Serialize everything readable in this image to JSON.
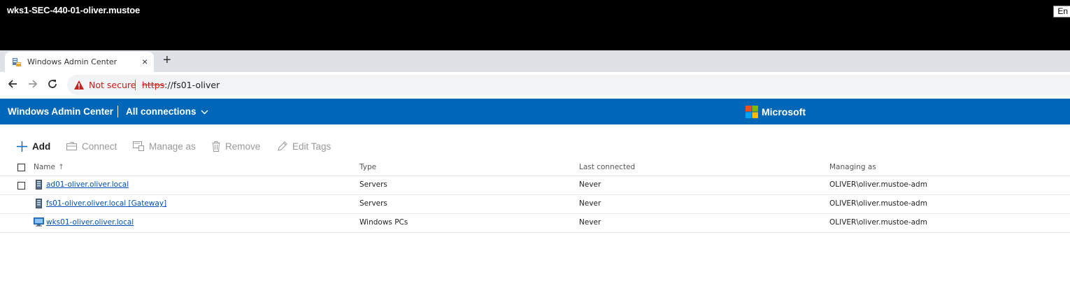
{
  "session": {
    "title": "wks1-SEC-440-01-oliver.mustoe",
    "language": "En"
  },
  "browser": {
    "tab_title": "Windows Admin Center",
    "tab_close": "×",
    "new_tab": "+",
    "not_secure": "Not secure",
    "url_scheme": "https",
    "url_rest": "://fs01-oliver"
  },
  "app": {
    "name": "Windows Admin Center",
    "connections_label": "All connections",
    "brand": "Microsoft",
    "brand_colors": [
      "#f25022",
      "#7fba00",
      "#00a4ef",
      "#ffb900"
    ],
    "header_color": "#0067b8"
  },
  "commands": {
    "add": "Add",
    "connect": "Connect",
    "manage_as": "Manage as",
    "remove": "Remove",
    "edit_tags": "Edit Tags"
  },
  "grid": {
    "columns": {
      "name": "Name",
      "type": "Type",
      "last_connected": "Last connected",
      "managing_as": "Managing as"
    },
    "sort_indicator": "↑",
    "rows": [
      {
        "name": "ad01-oliver.oliver.local",
        "type": "Servers",
        "last_connected": "Never",
        "managing_as": "OLIVER\\oliver.mustoe-adm",
        "icon": "server-icon"
      },
      {
        "name": "fs01-oliver.oliver.local [Gateway]",
        "type": "Servers",
        "last_connected": "Never",
        "managing_as": "OLIVER\\oliver.mustoe-adm",
        "icon": "server-icon"
      },
      {
        "name": "wks01-oliver.oliver.local",
        "type": "Windows PCs",
        "last_connected": "Never",
        "managing_as": "OLIVER\\oliver.mustoe-adm",
        "icon": "pc-icon"
      }
    ]
  }
}
